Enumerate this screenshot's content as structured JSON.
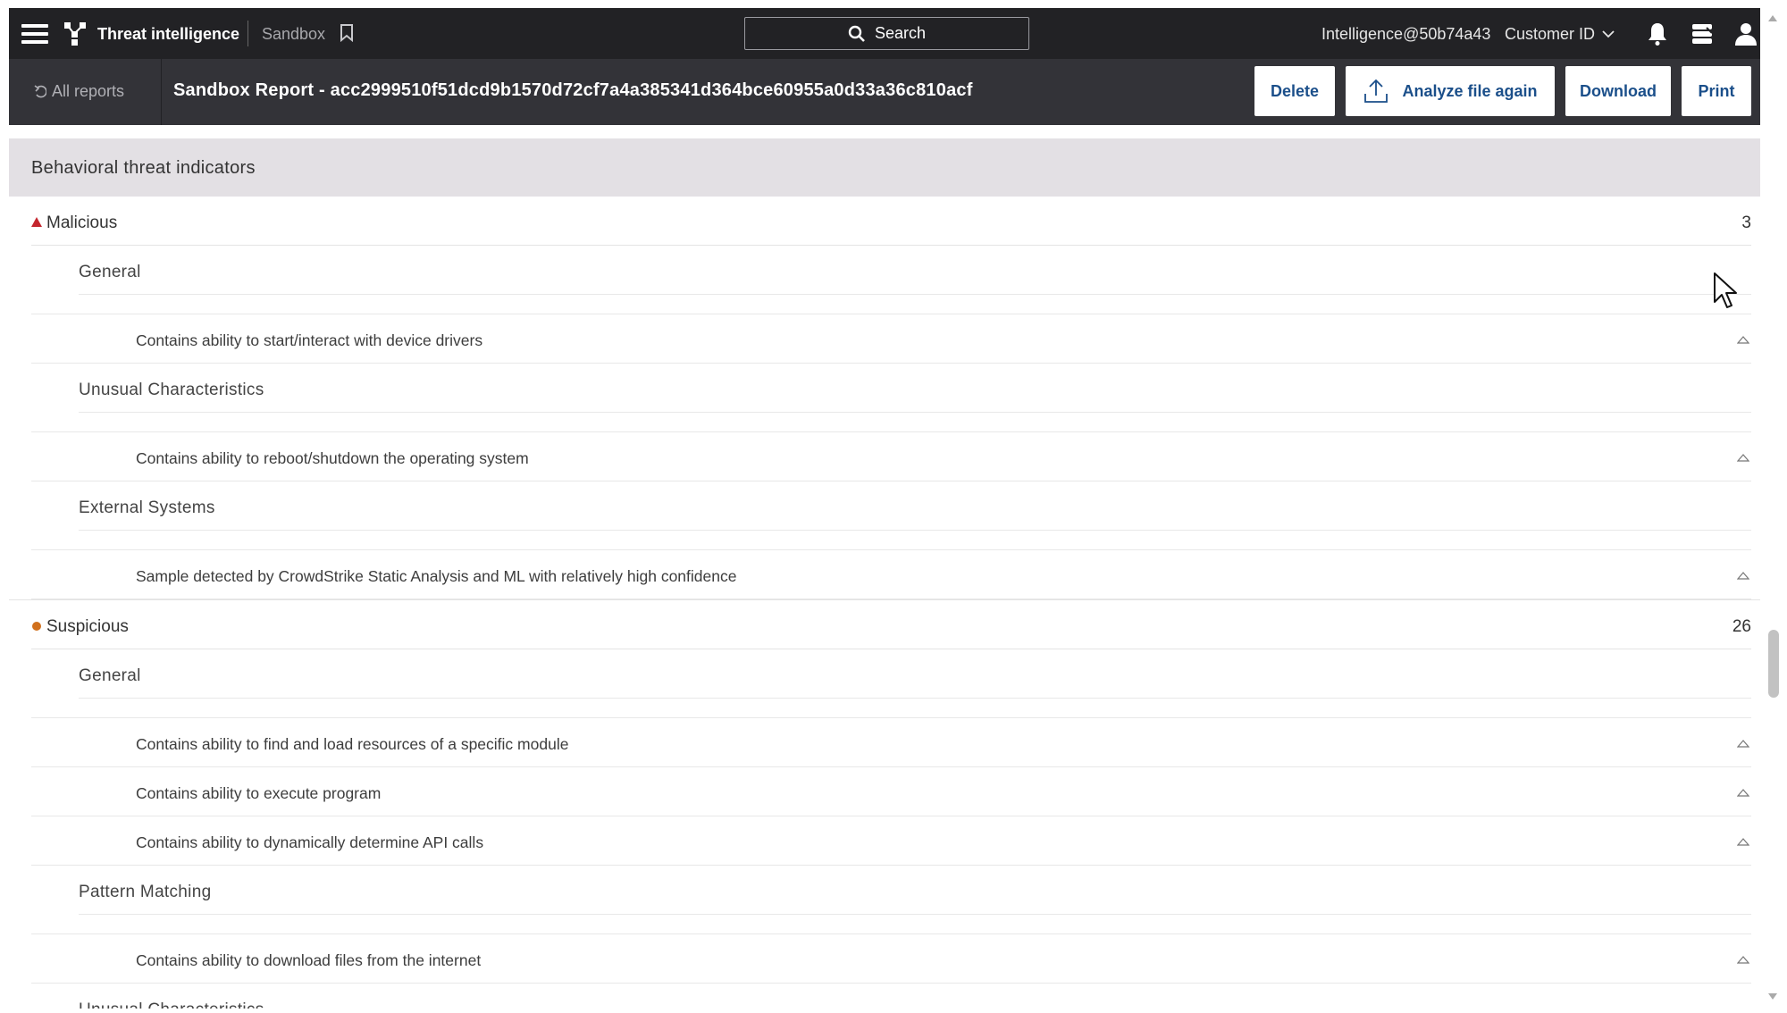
{
  "topbar": {
    "app_title": "Threat intelligence",
    "section": "Sandbox",
    "search_label": "Search",
    "user_email": "Intelligence@50b74a43",
    "customer_id_label": "Customer ID",
    "icons": [
      "menu-icon",
      "crowdstrike-logo-icon",
      "bookmark-icon",
      "search-icon",
      "chevron-down-icon",
      "bell-icon",
      "support-icon",
      "user-icon"
    ]
  },
  "report_header": {
    "back_label": "All reports",
    "title": "Sandbox Report - acc2999510f51dcd9b1570d72cf7a4a385341d364bce60955a0d33a36c810acf",
    "buttons": {
      "delete": "Delete",
      "analyze": "Analyze file again",
      "download": "Download",
      "print": "Print"
    }
  },
  "section_title": "Behavioral threat indicators",
  "severity_colors": {
    "malicious": "#c4262e",
    "suspicious": "#d1701c"
  },
  "groups": [
    {
      "label": "Malicious",
      "count": "3",
      "categories": [
        {
          "label": "General",
          "indicators": [
            "Contains ability to start/interact with device drivers"
          ]
        },
        {
          "label": "Unusual Characteristics",
          "indicators": [
            "Contains ability to reboot/shutdown the operating system"
          ]
        },
        {
          "label": "External Systems",
          "indicators": [
            "Sample detected by CrowdStrike Static Analysis and ML with relatively high confidence"
          ]
        }
      ]
    },
    {
      "label": "Suspicious",
      "count": "26",
      "categories": [
        {
          "label": "General",
          "indicators": [
            "Contains ability to find and load resources of a specific module",
            "Contains ability to execute program",
            "Contains ability to dynamically determine API calls"
          ]
        },
        {
          "label": "Pattern Matching",
          "indicators": [
            "Contains ability to download files from the internet"
          ]
        },
        {
          "label": "Unusual Characteristics",
          "indicators": []
        }
      ]
    }
  ]
}
